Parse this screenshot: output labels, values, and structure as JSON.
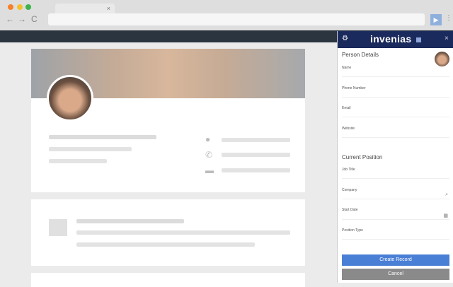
{
  "browser": {
    "tab_close": "×",
    "back": "←",
    "forward": "→",
    "reload": "C",
    "menu": "⋮",
    "extension_icon": "▶"
  },
  "panel": {
    "logo": "invenias",
    "close": "×",
    "gear": "⚙",
    "person_section": "Person Details",
    "person_fields": [
      {
        "label": "Name",
        "value": ""
      },
      {
        "label": "Phone Number",
        "value": ""
      },
      {
        "label": "Email",
        "value": ""
      },
      {
        "label": "Website",
        "value": ""
      }
    ],
    "position_section": "Current Position",
    "position_fields": [
      {
        "label": "Job Title",
        "value": ""
      },
      {
        "label": "Company",
        "value": "",
        "icon": "search-icon"
      },
      {
        "label": "Start Date",
        "value": "",
        "icon": "calendar-icon"
      },
      {
        "label": "Position Type",
        "value": ""
      }
    ],
    "create_label": "Create Record",
    "cancel_label": "Cancel",
    "colors": {
      "header": "#1b2a5c",
      "create": "#4a7fd6",
      "cancel": "#8a8a8a"
    }
  }
}
